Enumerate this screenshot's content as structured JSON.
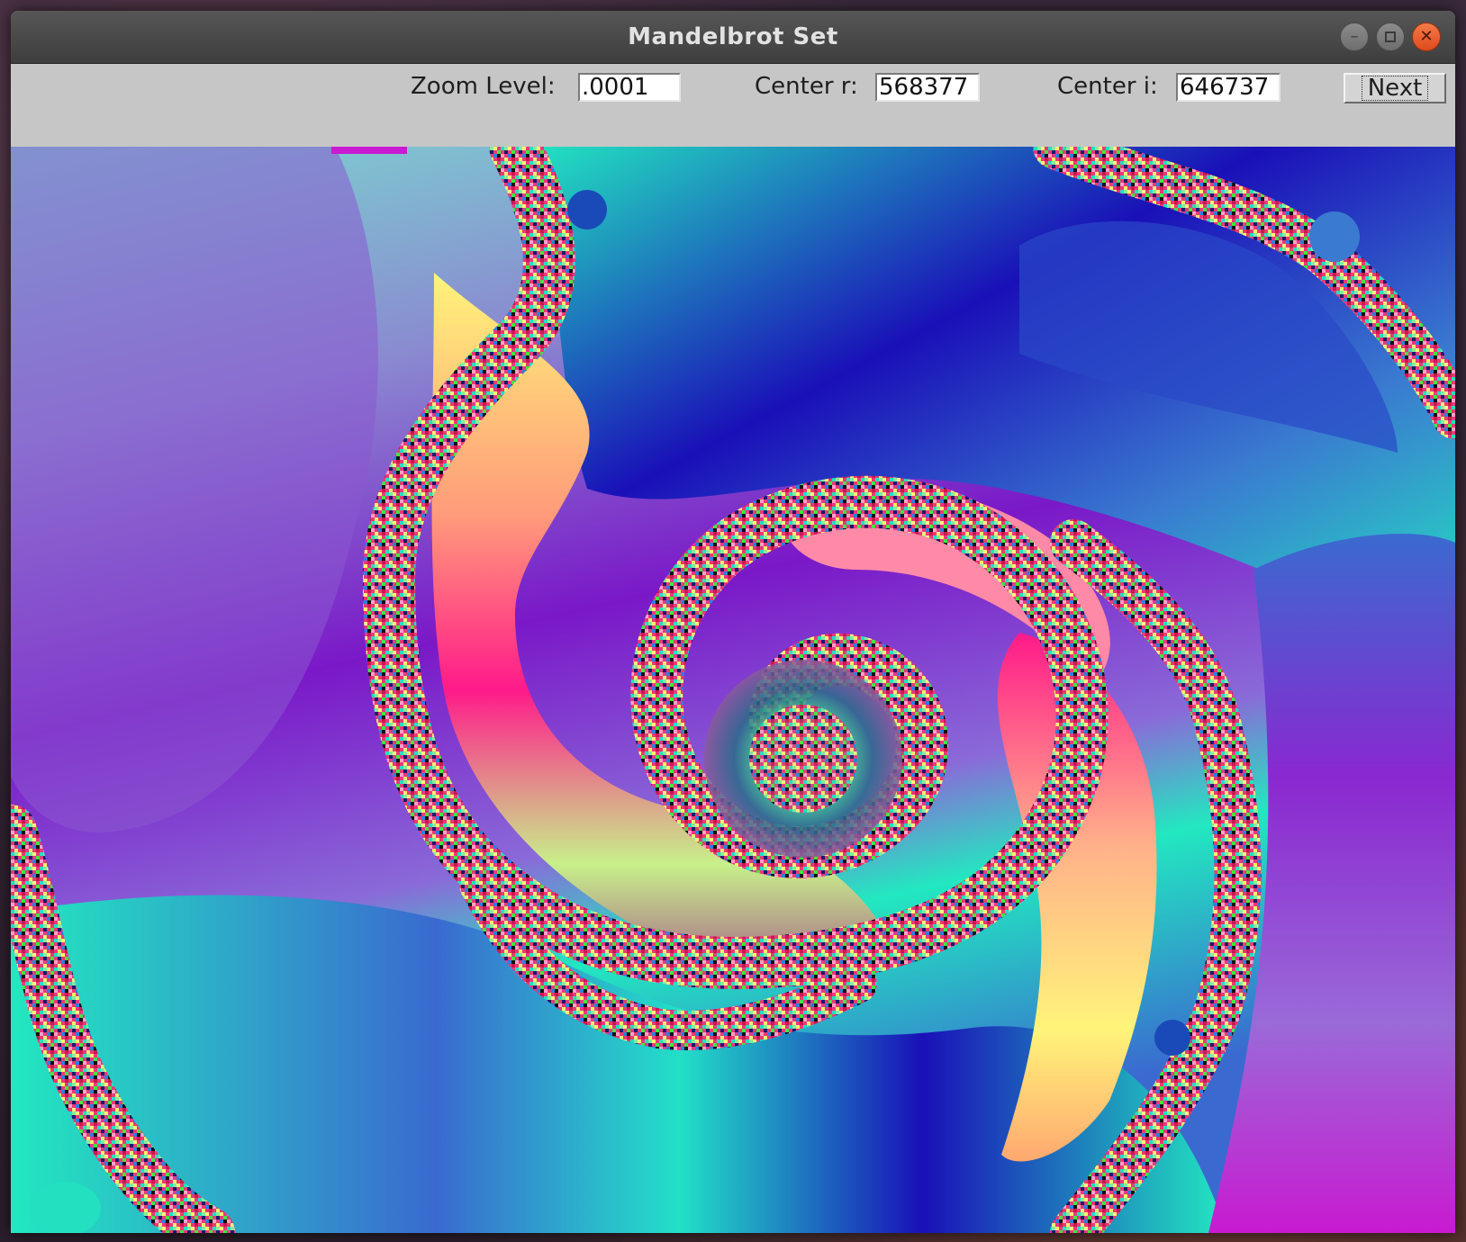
{
  "window": {
    "title": "Mandelbrot Set"
  },
  "controls": {
    "zoom_label": "Zoom Level:",
    "zoom_value": ".0001",
    "center_r_label": "Center r:",
    "center_r_value": "568377",
    "center_i_label": "Center i:",
    "center_i_value": "646737",
    "next_label": "Next"
  },
  "icons": {
    "minimize": "minimize-icon",
    "maximize": "maximize-icon",
    "close": "close-icon"
  },
  "colors": {
    "titlebar": "#4a4a4a",
    "toolbar": "#c6c6c6",
    "close_button": "#e8582a",
    "fractal_palette": [
      "#1a0fb8",
      "#3a6fd0",
      "#22e8c0",
      "#7fd8c8",
      "#9a4fd8",
      "#7a10c8",
      "#ff1a8a",
      "#ffa070",
      "#fff47a",
      "#c8f08a",
      "#40e890"
    ]
  }
}
